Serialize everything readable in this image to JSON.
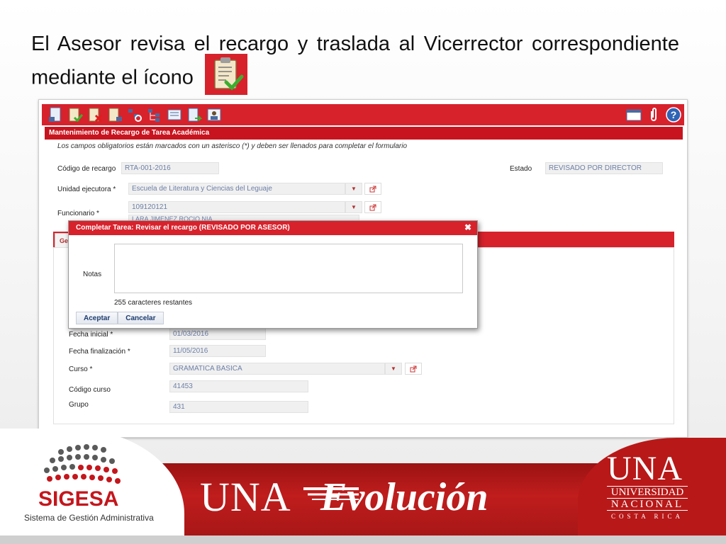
{
  "caption": {
    "text": "El Asesor revisa el recargo y traslada al Vicerrector correspondiente mediante el ícono",
    "icon": "clipboard-check-icon"
  },
  "toolbar": {
    "icons": [
      "new-document-icon",
      "clipboard-approve-icon",
      "clipboard-reject-icon",
      "clipboard-edit-icon",
      "hierarchy-search-icon",
      "hierarchy-icon",
      "form-icon",
      "document-send-icon",
      "user-card-icon"
    ],
    "right_icons": [
      "window-icon",
      "attachment-icon",
      "help-icon"
    ]
  },
  "form": {
    "section_title": "Mantenimiento de Recargo de Tarea Académica",
    "notice": "Los campos obligatorios están marcados con un asterisco (*) y deben ser llenados para completar el formulario",
    "codigo_label": "Código de recargo",
    "codigo_value": "RTA-001-2016",
    "estado_label": "Estado",
    "estado_value": "REVISADO POR DIRECTOR",
    "unidad_label": "Unidad ejecutora *",
    "unidad_value": "Escuela de Literatura y Ciencias del Leguaje",
    "funcionario_label": "Funcionario *",
    "funcionario_id": "109120121",
    "funcionario_name": "LARA JIMENEZ ROCIO NIA",
    "tab_label": "Ge",
    "fecha_inicial_label": "Fecha inicial *",
    "fecha_inicial_value": "01/03/2016",
    "fecha_fin_label": "Fecha finalización *",
    "fecha_fin_value": "11/05/2016",
    "curso_label": "Curso *",
    "curso_value": "GRAMATICA BASICA",
    "codigo_curso_label": "Código curso",
    "codigo_curso_value": "41453",
    "grupo_label": "Grupo",
    "grupo_value": "431"
  },
  "modal": {
    "title": "Completar Tarea: Revisar el recargo (REVISADO POR ASESOR)",
    "close": "✖",
    "notes_label": "Notas",
    "notes_value": "",
    "chars_left": "255 caracteres restantes",
    "accept": "Aceptar",
    "cancel": "Cancelar"
  },
  "footer": {
    "sigesa": "SIGESA",
    "sigesa_sub": "Sistema de Gestión Administrativa",
    "una": "UNA",
    "evolucion": "Evolución",
    "una_right": "UNA",
    "universidad": "UNIVERSIDAD",
    "nacional": "NACIONAL",
    "costa_rica": "COSTA RICA"
  },
  "colors": {
    "brand_red": "#d7222c",
    "field_text": "#6d7fa6",
    "button_text": "#1d3b6e"
  }
}
